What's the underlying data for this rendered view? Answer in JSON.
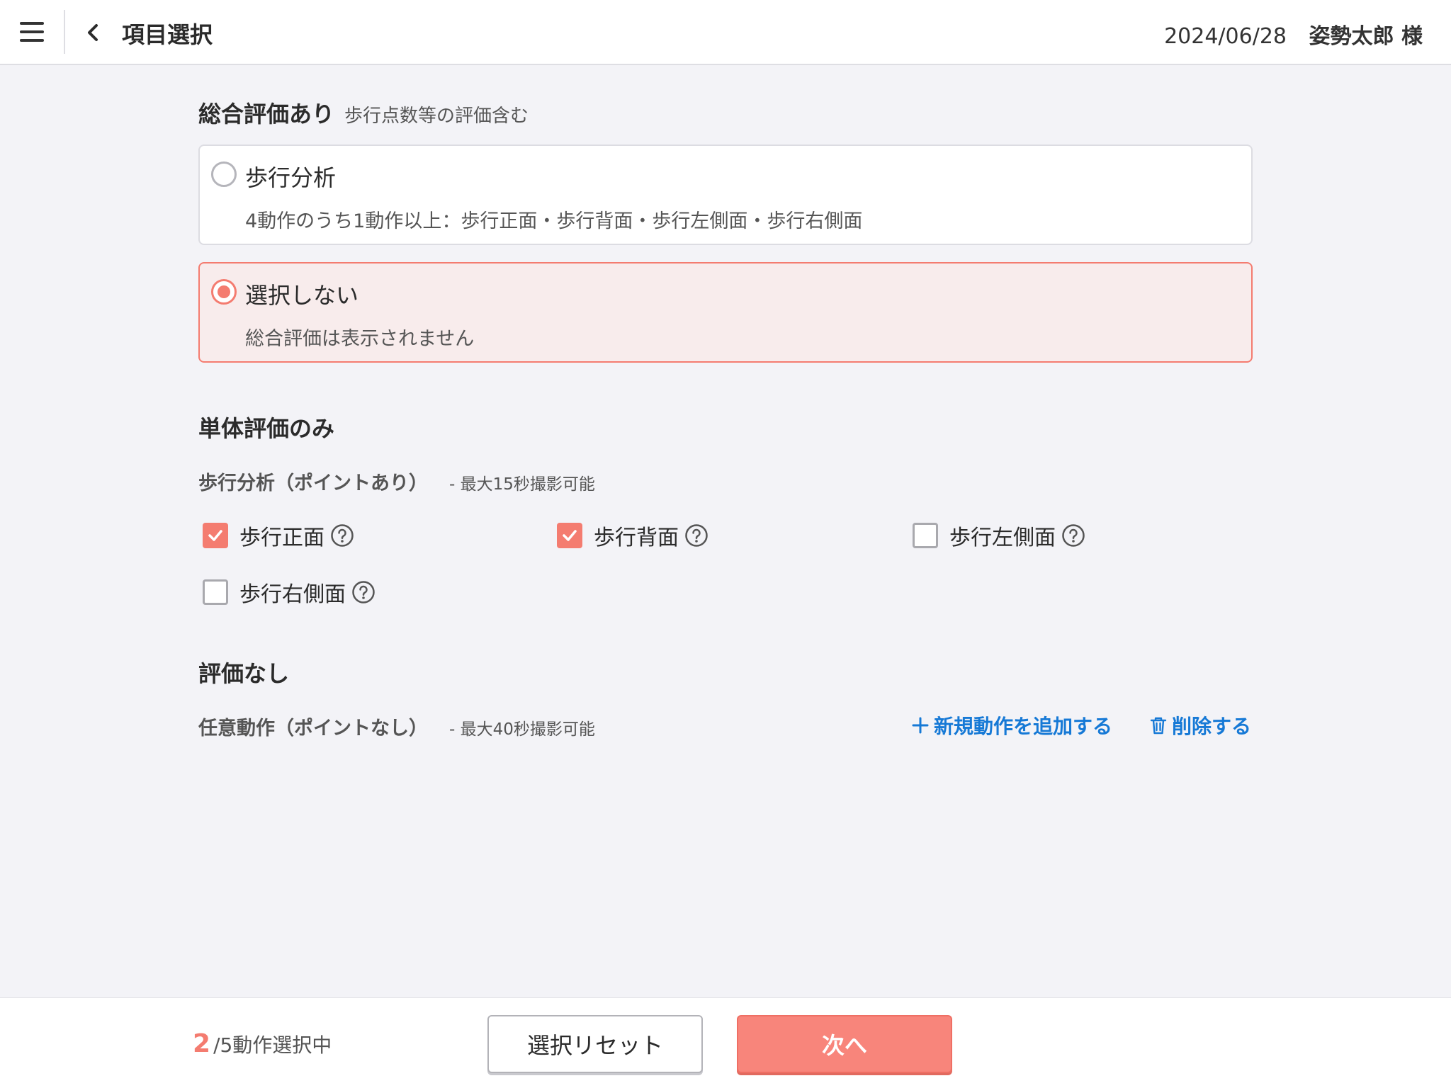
{
  "header": {
    "title": "項目選択",
    "date": "2024/06/28",
    "user": "姿勢太郎 様"
  },
  "comprehensive": {
    "heading": "総合評価あり",
    "sub": "歩行点数等の評価含む",
    "options": [
      {
        "title": "歩行分析",
        "desc": "4動作のうち1動作以上：歩行正面・歩行背面・歩行左側面・歩行右側面",
        "selected": false
      },
      {
        "title": "選択しない",
        "desc": "総合評価は表示されません",
        "selected": true
      }
    ]
  },
  "single": {
    "heading": "単体評価のみ",
    "group_label": "歩行分析（ポイントあり）",
    "group_note": "- 最大15秒撮影可能",
    "items": [
      {
        "label": "歩行正面",
        "checked": true
      },
      {
        "label": "歩行背面",
        "checked": true
      },
      {
        "label": "歩行左側面",
        "checked": false
      },
      {
        "label": "歩行右側面",
        "checked": false
      }
    ]
  },
  "none": {
    "heading": "評価なし",
    "group_label": "任意動作（ポイントなし）",
    "group_note": "- 最大40秒撮影可能",
    "add_label": "新規動作を追加する",
    "delete_label": "削除する"
  },
  "footer": {
    "count_selected": "2",
    "count_suffix": "/5動作選択中",
    "reset_label": "選択リセット",
    "next_label": "次へ"
  },
  "colors": {
    "accent": "#f47c70",
    "link": "#1679d6",
    "selected_bg": "#f8ecec"
  }
}
